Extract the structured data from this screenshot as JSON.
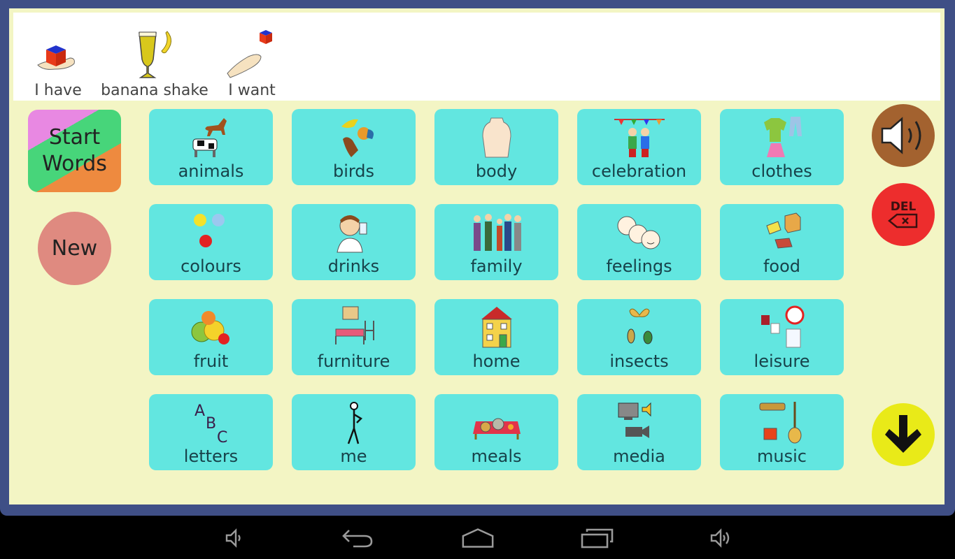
{
  "sentence": {
    "words": [
      {
        "label": "I have",
        "icon": "hand-holding-cube-icon"
      },
      {
        "label": "banana shake",
        "icon": "milkshake-banana-icon"
      },
      {
        "label": "I want",
        "icon": "hand-reaching-cube-icon"
      }
    ]
  },
  "left_buttons": {
    "start_words": "Start Words",
    "new": "New"
  },
  "tiles": [
    {
      "label": "animals",
      "icon": "horse-cow-icon"
    },
    {
      "label": "birds",
      "icon": "birds-icon"
    },
    {
      "label": "body",
      "icon": "torso-icon"
    },
    {
      "label": "celebration",
      "icon": "party-people-icon"
    },
    {
      "label": "clothes",
      "icon": "clothes-icon"
    },
    {
      "label": "colours",
      "icon": "paint-splats-icon"
    },
    {
      "label": "drinks",
      "icon": "person-drinking-icon"
    },
    {
      "label": "family",
      "icon": "family-group-icon"
    },
    {
      "label": "feelings",
      "icon": "faces-icon"
    },
    {
      "label": "food",
      "icon": "food-items-icon"
    },
    {
      "label": "fruit",
      "icon": "fruit-bowl-icon"
    },
    {
      "label": "furniture",
      "icon": "furniture-icon"
    },
    {
      "label": "home",
      "icon": "house-icon"
    },
    {
      "label": "insects",
      "icon": "insects-icon"
    },
    {
      "label": "leisure",
      "icon": "leisure-icon"
    },
    {
      "label": "letters",
      "icon": "abc-letters-icon"
    },
    {
      "label": "me",
      "icon": "stick-figure-icon"
    },
    {
      "label": "meals",
      "icon": "meal-table-icon"
    },
    {
      "label": "media",
      "icon": "tv-camera-icon"
    },
    {
      "label": "music",
      "icon": "instruments-icon"
    }
  ],
  "right_buttons": {
    "speak": "speaker-icon",
    "delete_label": "DEL",
    "scroll_down": "arrow-down-icon"
  },
  "colors": {
    "frame": "#3f4f86",
    "background": "#f3f5c4",
    "tile": "#62e6e0",
    "speak": "#a3622f",
    "delete": "#ed2d2d",
    "down": "#e9ea18",
    "new": "#df8a80"
  },
  "system_nav": [
    "volume-down-icon",
    "back-icon",
    "home-icon",
    "recent-apps-icon",
    "volume-up-icon"
  ]
}
